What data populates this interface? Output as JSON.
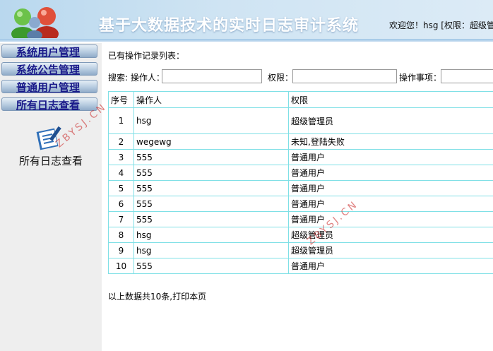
{
  "header": {
    "title": "基于大数据技术的实时日志审计系统",
    "welcome": "欢迎您！hsg [权限：超级管理"
  },
  "sidebar": {
    "items": [
      {
        "label": "系统用户管理"
      },
      {
        "label": "系统公告管理"
      },
      {
        "label": "普通用户管理"
      },
      {
        "label": "所有日志查看"
      }
    ],
    "caption": "所有日志查看"
  },
  "main": {
    "list_title": "已有操作记录列表：",
    "search": {
      "label_prefix": "搜索: 操作人：",
      "operator_value": "",
      "permission_label": "权限：",
      "permission_value": "",
      "action_label": "操作事项：",
      "action_value": ""
    },
    "table": {
      "columns": [
        "序号",
        "操作人",
        "权限"
      ],
      "rows": [
        {
          "no": "1",
          "operator": "hsg",
          "permission": "超级管理员"
        },
        {
          "no": "2",
          "operator": "wegewg",
          "permission": "未知,登陆失败"
        },
        {
          "no": "3",
          "operator": "555",
          "permission": "普通用户"
        },
        {
          "no": "4",
          "operator": "555",
          "permission": "普通用户"
        },
        {
          "no": "5",
          "operator": "555",
          "permission": "普通用户"
        },
        {
          "no": "6",
          "operator": "555",
          "permission": "普通用户"
        },
        {
          "no": "7",
          "operator": "555",
          "permission": "普通用户"
        },
        {
          "no": "8",
          "operator": "hsg",
          "permission": "超级管理员"
        },
        {
          "no": "9",
          "operator": "hsg",
          "permission": "超级管理员"
        },
        {
          "no": "10",
          "operator": "555",
          "permission": "普通用户"
        }
      ]
    },
    "footer_note": "以上数据共10条,打印本页"
  },
  "watermark": "ZBYSJ.CN",
  "icons": {
    "logo": "users-logo-icon",
    "sidebar": "document-edit-icon"
  }
}
